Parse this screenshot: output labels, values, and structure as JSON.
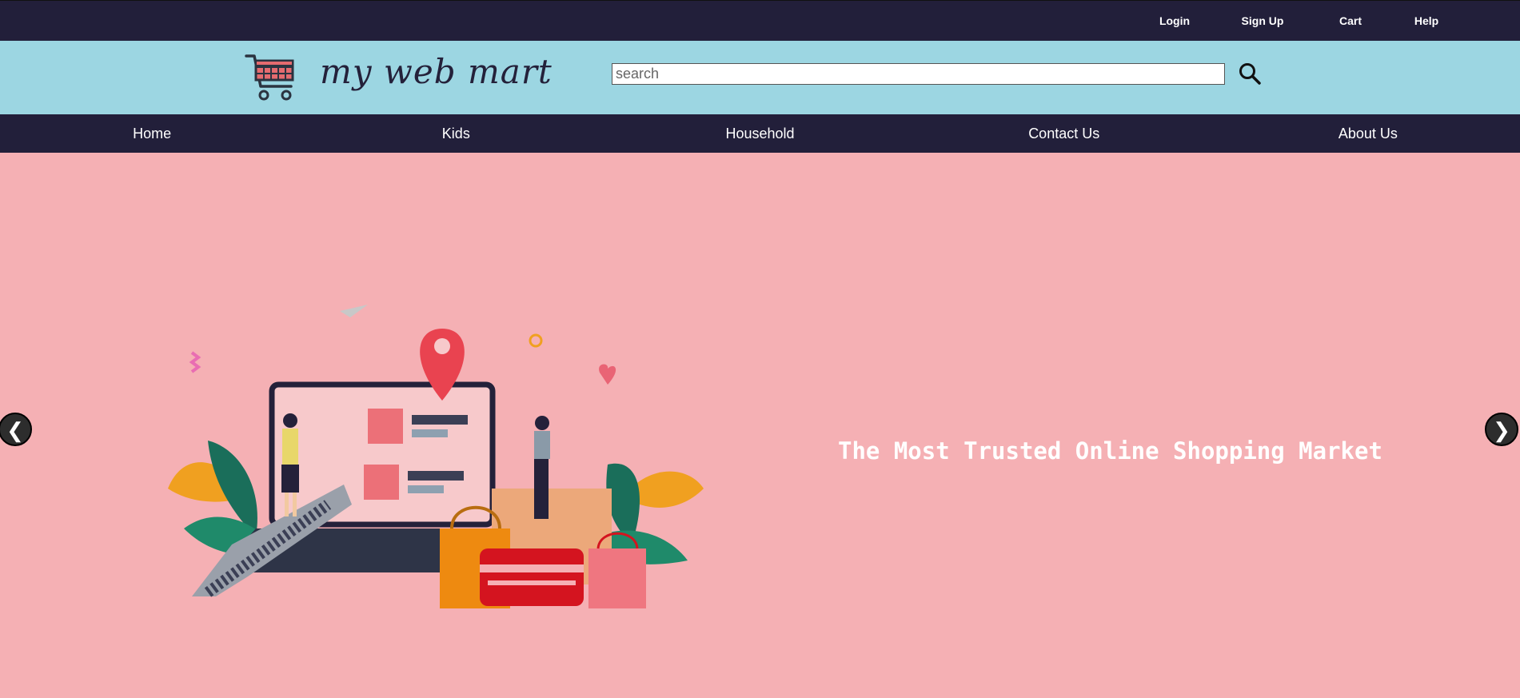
{
  "top_links": {
    "login": "Login",
    "signup": "Sign Up",
    "cart": "Cart",
    "help": "Help"
  },
  "header": {
    "logo_text": "my web mart",
    "logo_icon": "shopping-cart-icon",
    "search_placeholder": "search",
    "search_icon": "magnifier-icon"
  },
  "nav": {
    "items": [
      "Home",
      "Kids",
      "Household",
      "Contact Us",
      "About Us"
    ]
  },
  "hero": {
    "title": "The Most Trusted Online Shopping Market",
    "prev_arrow": "❮",
    "next_arrow": "❯"
  },
  "colors": {
    "dark_navy": "#221f3a",
    "header_blue": "#9cd6e2",
    "hero_pink": "#f5b0b4"
  }
}
